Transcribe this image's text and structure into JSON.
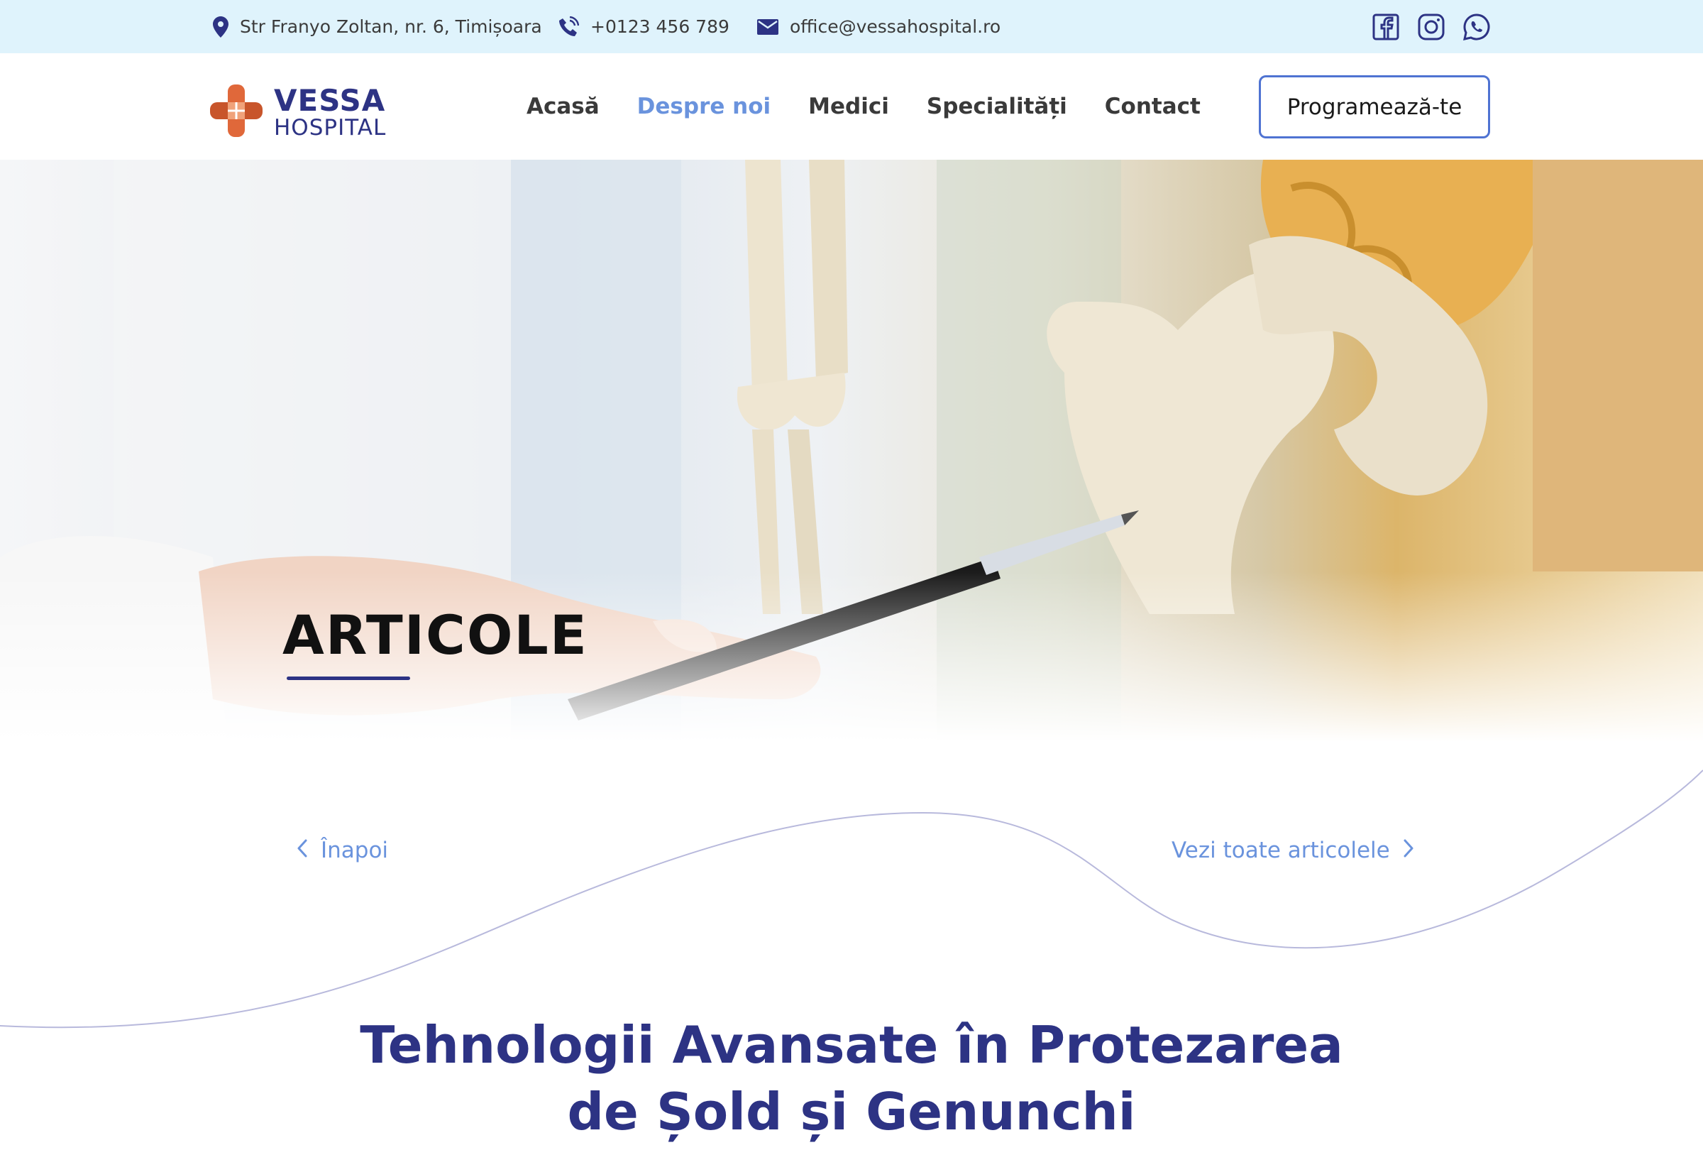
{
  "topbar": {
    "address": "Str Franyo Zoltan, nr. 6, Timișoara",
    "phone": "+0123 456 789",
    "email": "office@vessahospital.ro",
    "icons": [
      "map-pin-icon",
      "phone-icon",
      "mail-icon",
      "facebook-icon",
      "instagram-icon",
      "whatsapp-icon"
    ]
  },
  "header": {
    "logo_main": "VESSA",
    "logo_sub": "HOSPITAL",
    "nav": [
      {
        "label": "Acasă",
        "active": false
      },
      {
        "label": "Despre noi",
        "active": true
      },
      {
        "label": "Medici",
        "active": false
      },
      {
        "label": "Specialități",
        "active": false
      },
      {
        "label": "Contact",
        "active": false
      }
    ],
    "cta_label": "Programează-te"
  },
  "hero": {
    "title": "ARTICOLE"
  },
  "article_nav": {
    "back_label": "Înapoi",
    "all_label": "Vezi toate articolele"
  },
  "article": {
    "title_line1": "Tehnologii Avansate în Protezarea",
    "title_line2": "de Șold și Genunchi"
  },
  "colors": {
    "brand_navy": "#2d3384",
    "accent_blue": "#6a93dd",
    "cta_border": "#4f73d2",
    "topbar_bg": "#dff3fc",
    "logo_orange": "#e0683a"
  }
}
